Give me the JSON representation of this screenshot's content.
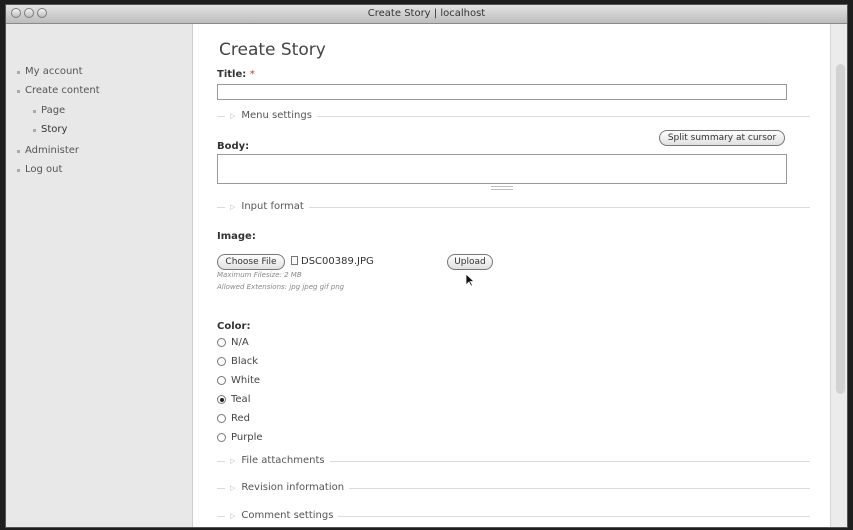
{
  "window": {
    "title": "Create Story | localhost"
  },
  "sidebar": {
    "items": [
      {
        "label": "My account"
      },
      {
        "label": "Create content"
      },
      {
        "label": "Page"
      },
      {
        "label": "Story"
      },
      {
        "label": "Administer"
      },
      {
        "label": "Log out"
      }
    ]
  },
  "page": {
    "title": "Create Story"
  },
  "form": {
    "title_label": "Title:",
    "required_mark": "*",
    "title_value": "",
    "menu_settings": "Menu settings",
    "body_label": "Body:",
    "split_button": "Split summary at cursor",
    "input_format": "Input format",
    "image_label": "Image:",
    "choose_file": "Choose File",
    "file_name": "DSC00389.JPG",
    "upload_button": "Upload",
    "max_filesize": "Maximum Filesize: 2 MB",
    "allowed_ext": "Allowed Extensions: jpg jpeg gif png",
    "color_label": "Color:",
    "color_options": [
      "N/A",
      "Black",
      "White",
      "Teal",
      "Red",
      "Purple"
    ],
    "color_selected": "Teal",
    "file_attachments": "File attachments",
    "revision_info": "Revision information",
    "comment_settings": "Comment settings"
  },
  "icons": {
    "collapse": "triangle-right-icon",
    "file": "document-icon",
    "cursor": "mouse-pointer-icon"
  }
}
